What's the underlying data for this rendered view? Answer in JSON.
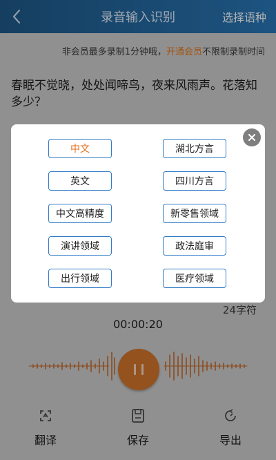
{
  "header": {
    "title": "录音输入识别",
    "action": "选择语种"
  },
  "notice": {
    "prefix": "非会员最多录制1分钟哦，",
    "link": "开通会员",
    "suffix": "不限制录制时间"
  },
  "content": {
    "text": "春眠不觉晓，处处闻啼鸟，夜来风雨声。花落知多少？"
  },
  "recording": {
    "char_count": "24字符",
    "timer": "00:00:20"
  },
  "toolbar": {
    "translate": "翻译",
    "save": "保存",
    "export": "导出"
  },
  "language_modal": {
    "selected": "中文",
    "left_options": [
      "中文",
      "英文",
      "中文高精度",
      "演讲领域",
      "出行领域"
    ],
    "right_options": [
      "湖北方言",
      "四川方言",
      "新零售领域",
      "政法庭审",
      "医疗领域"
    ]
  },
  "colors": {
    "header_start": "#1f5a8a",
    "header_end": "#2a78b8",
    "accent_orange": "#d4762d",
    "link_orange": "#e87817",
    "option_border": "#2f7bc6"
  }
}
